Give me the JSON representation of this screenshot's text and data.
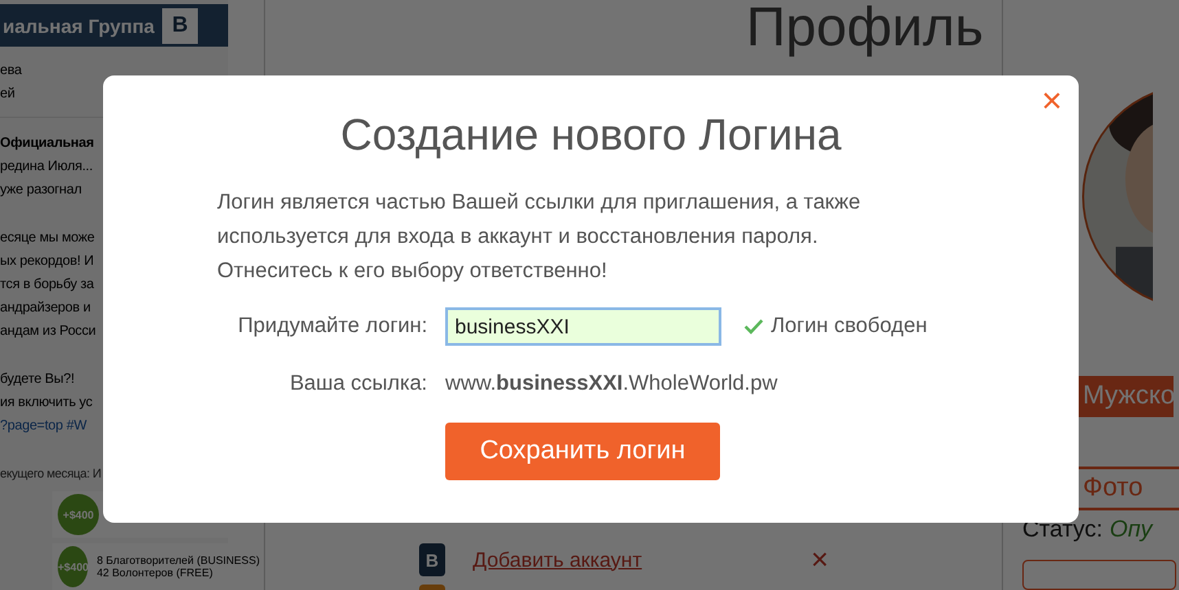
{
  "sidebar": {
    "header": "иальная Группа",
    "header_logo": "В",
    "paragraphs": [
      {
        "kind": "author",
        "lines": [
          "ева",
          "ей"
        ]
      },
      {
        "kind": "post",
        "lines": [
          {
            "kind": "bold",
            "text": "Официальная"
          },
          {
            "kind": "text",
            "text": "редина Июля..."
          },
          {
            "kind": "text",
            "text": "уже разогнал"
          }
        ]
      },
      {
        "kind": "post",
        "lines": [
          {
            "kind": "text",
            "text": "есяце мы може"
          },
          {
            "kind": "text",
            "text": "ых рекордов! И"
          },
          {
            "kind": "text",
            "text": "тся в борьбу за"
          },
          {
            "kind": "text",
            "text": "андрайзеров и"
          },
          {
            "kind": "text",
            "text": "андам из Росси"
          }
        ]
      },
      {
        "kind": "post",
        "lines": [
          {
            "kind": "text",
            "text": "будете Вы?!"
          },
          {
            "kind": "text",
            "text": "ия включить ус"
          },
          {
            "kind": "link",
            "text": "?page=top #W"
          }
        ]
      },
      {
        "kind": "post",
        "lines": [
          {
            "kind": "small",
            "text": "екущего месяца: И"
          }
        ]
      }
    ],
    "cards": [
      {
        "badge": "+$400"
      },
      {
        "badge": "+$400",
        "lines": [
          "8 Благотворителей (BUSINESS)",
          "42 Волонтеров (FREE)"
        ]
      }
    ]
  },
  "main": {
    "title": "Профиль",
    "accounts": [
      {
        "icon": "В",
        "label": "Добавить аккаунт",
        "remove": "×"
      }
    ]
  },
  "profile": {
    "gender": "Мужско",
    "photo_tab": "Фото",
    "status_label": "Статус:",
    "status_value": "Опу"
  },
  "modal": {
    "title": "Создание нового Логина",
    "close": "×",
    "description": "Логин является частью Вашей ссылки для приглашения, а также используется для входа в аккаунт и восстановления пароля. Отнеситесь к его выбору ответственно!",
    "login_label": "Придумайте логин:",
    "login_value": "businessXXI",
    "login_available": true,
    "login_status": "Логин свободен",
    "link_label": "Ваша ссылка:",
    "link_value": "www.**businessXXI**.WholeWorld.pw",
    "save_button": "Сохранить логин"
  }
}
